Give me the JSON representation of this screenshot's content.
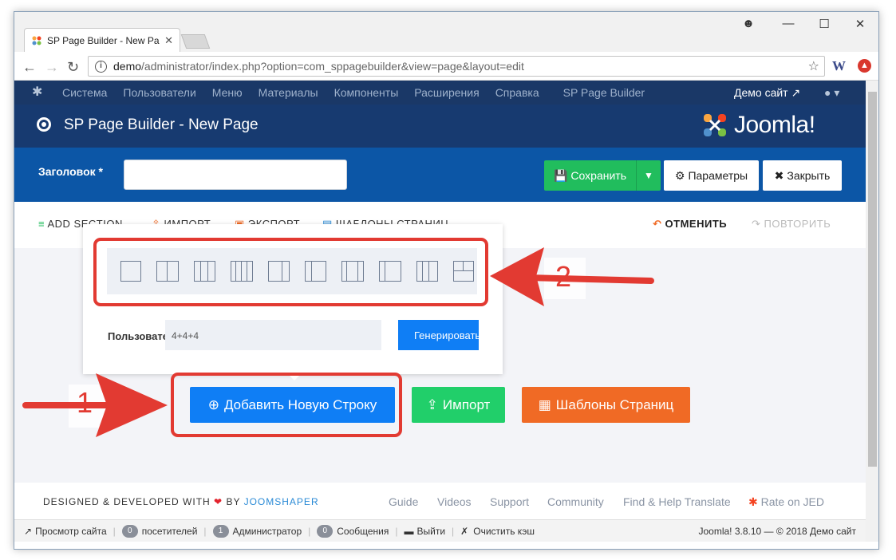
{
  "browser": {
    "tab_title": "SP Page Builder - New Pa",
    "url_host": "demo",
    "url_path": "/administrator/index.php?option=com_sppagebuilder&view=page&layout=edit",
    "ext_w": "W"
  },
  "joomla_menu": {
    "items": [
      "Система",
      "Пользователи",
      "Меню",
      "Материалы",
      "Компоненты",
      "Расширения",
      "Справка",
      "SP Page Builder"
    ],
    "site_link": "Демо сайт"
  },
  "header": {
    "title": "SP Page Builder - New Page",
    "brand": "Joomla!"
  },
  "toolbar": {
    "title_label": "Заголовок *",
    "title_value": "",
    "save_label": "Сохранить",
    "params_label": "Параметры",
    "close_label": "Закрыть"
  },
  "builder_bar": {
    "add_section": "ADD SECTION",
    "import": "ИМПОРТ",
    "export": "ЭКСПОРТ",
    "templates": "ШАБЛОНЫ СТРАНИЦ",
    "undo": "ОТМЕНИТЬ",
    "redo": "ПОВТОРИТЬ"
  },
  "layout_popup": {
    "custom_label": "Пользовательский",
    "custom_value": "4+4+4",
    "generate_label": "Генерировать"
  },
  "actions": {
    "add_row": "Добавить Новую Строку",
    "import": "Импорт",
    "templates": "Шаблоны Страниц"
  },
  "footer": {
    "credit_a": "DESIGNED & DEVELOPED WITH",
    "credit_b": "BY",
    "credit_brand": "JOOMSHAPER",
    "links": [
      "Guide",
      "Videos",
      "Support",
      "Community",
      "Find & Help Translate",
      "Rate on JED"
    ]
  },
  "status": {
    "view_site": "Просмотр сайта",
    "visitors_count": "0",
    "visitors": "посетителей",
    "admins_count": "1",
    "admins": "Администратор",
    "messages_count": "0",
    "messages": "Сообщения",
    "logout": "Выйти",
    "clear_cache": "Очистить кэш",
    "version": "Joomla! 3.8.10 — © 2018 Демо сайт"
  },
  "annotations": {
    "marker_1": "1",
    "marker_2": "2"
  },
  "colors": {
    "menu_bg": "#1a3867",
    "header_bg": "#173a70",
    "toolbar_bg": "#0c56a6",
    "save_green": "#21bd5d",
    "add_row_blue": "#0f7ef5",
    "import_green": "#21cf6a",
    "templates_orange": "#f06a25",
    "annotation_red": "#e23a32"
  }
}
